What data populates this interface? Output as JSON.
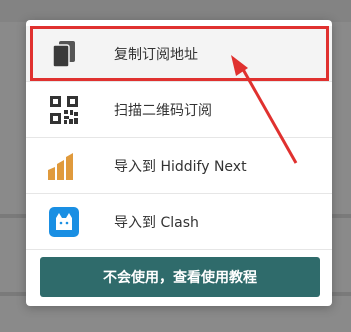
{
  "menu": {
    "items": [
      {
        "label": "复制订阅地址",
        "icon": "copy-icon"
      },
      {
        "label": "扫描二维码订阅",
        "icon": "qr-code-icon"
      },
      {
        "label": "导入到 Hiddify Next",
        "icon": "hiddify-icon"
      },
      {
        "label": "导入到 Clash",
        "icon": "clash-cat-icon"
      }
    ]
  },
  "footer": {
    "tutorial_label": "不会使用，查看使用教程"
  },
  "colors": {
    "highlight": "#e0312f",
    "button": "#2f6b6b",
    "hiddify": "#e09a3c",
    "clash": "#1a8fe3"
  }
}
